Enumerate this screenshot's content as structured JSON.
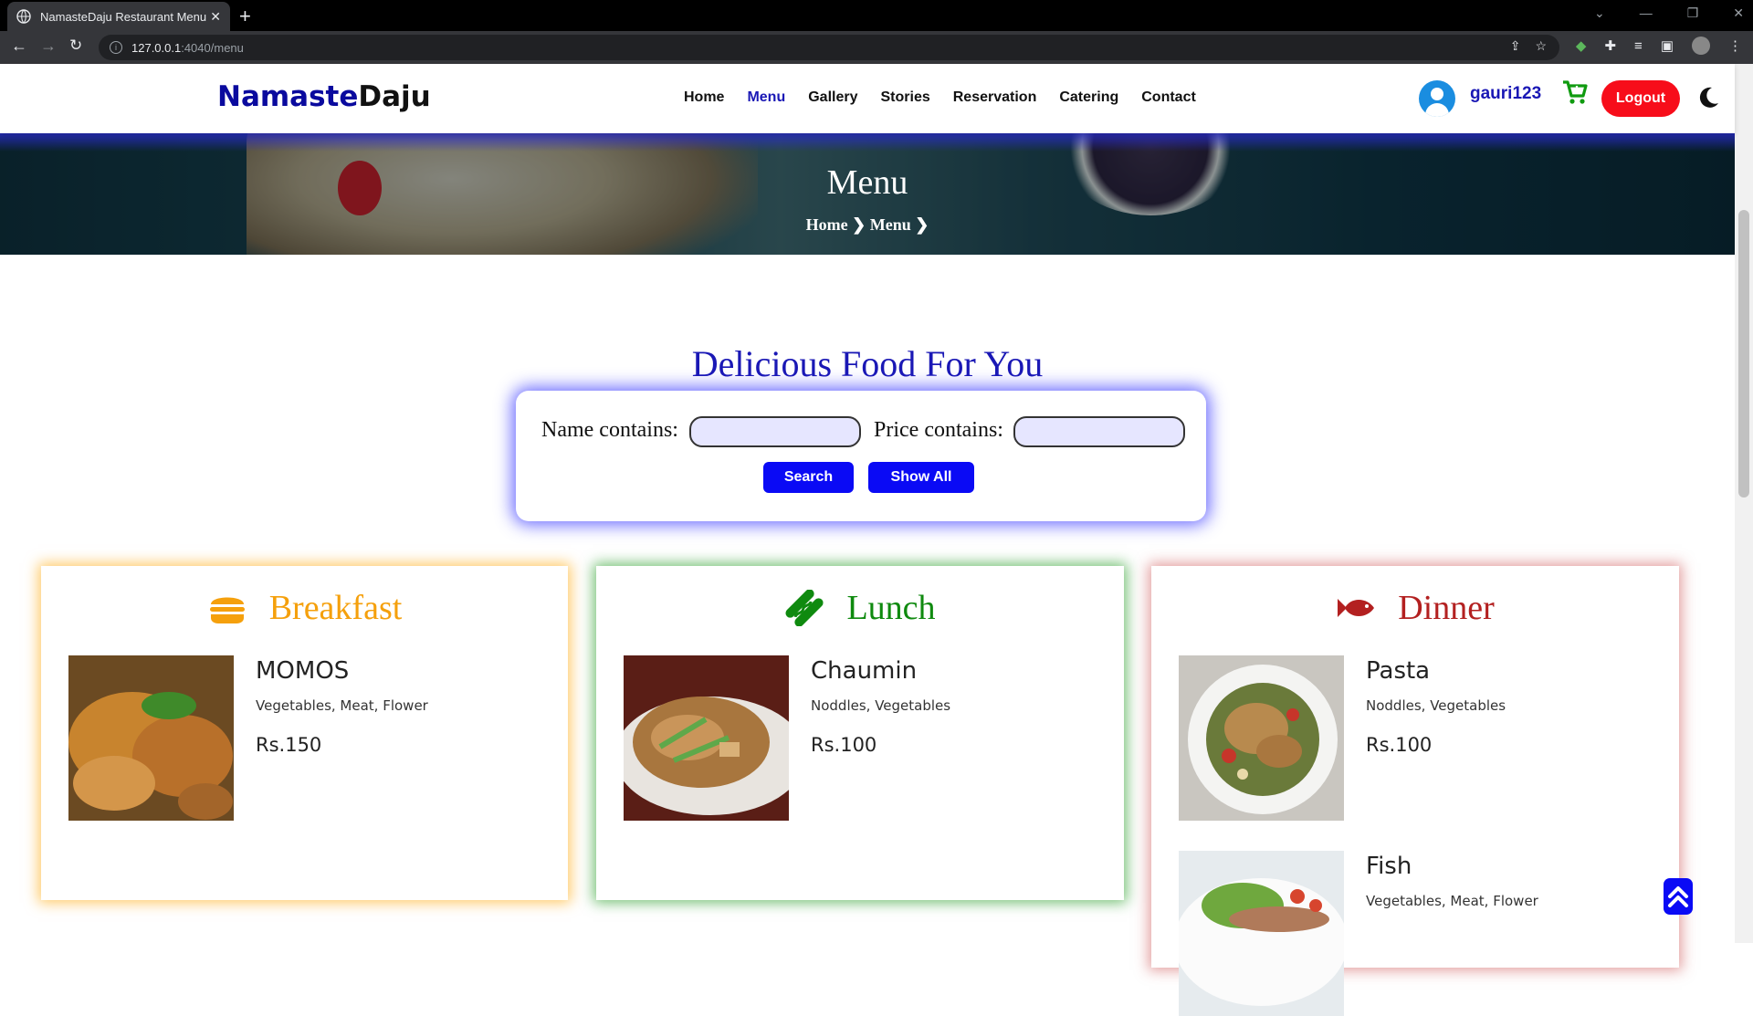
{
  "browser": {
    "tab_title": "NamasteDaju Restaurant Menu",
    "url_host": "127.0.0.1",
    "url_path": ":4040/menu"
  },
  "site": {
    "logo_part1": "Namaste",
    "logo_part2": "Daju",
    "nav": [
      "Home",
      "Menu",
      "Gallery",
      "Stories",
      "Reservation",
      "Catering",
      "Contact"
    ],
    "active_nav": "Menu",
    "username": "gauri123",
    "logout_label": "Logout"
  },
  "hero": {
    "title": "Menu",
    "breadcrumb": [
      "Home",
      "Menu"
    ]
  },
  "search": {
    "heading": "Delicious Food For You",
    "name_label": "Name contains:",
    "name_value": "",
    "price_label": "Price contains:",
    "price_value": "",
    "search_label": "Search",
    "show_all_label": "Show All"
  },
  "categories": [
    {
      "title": "Breakfast",
      "color": "#f5a00c",
      "icon": "burger-icon",
      "items": [
        {
          "name": "MOMOS",
          "desc": "Vegetables, Meat, Flower",
          "price": "Rs.150"
        }
      ]
    },
    {
      "title": "Lunch",
      "color": "#0f8a0f",
      "icon": "hotdog-icon",
      "items": [
        {
          "name": "Chaumin",
          "desc": "Noddles, Vegetables",
          "price": "Rs.100"
        }
      ]
    },
    {
      "title": "Dinner",
      "color": "#b32020",
      "icon": "fish-icon",
      "items": [
        {
          "name": "Pasta",
          "desc": "Noddles, Vegetables",
          "price": "Rs.100"
        },
        {
          "name": "Fish",
          "desc": "Vegetables, Meat, Flower",
          "price": ""
        }
      ]
    }
  ],
  "colors": {
    "brand_blue": "#1a18b5",
    "logout_red": "#f70d1a",
    "button_blue": "#0a0af5"
  }
}
